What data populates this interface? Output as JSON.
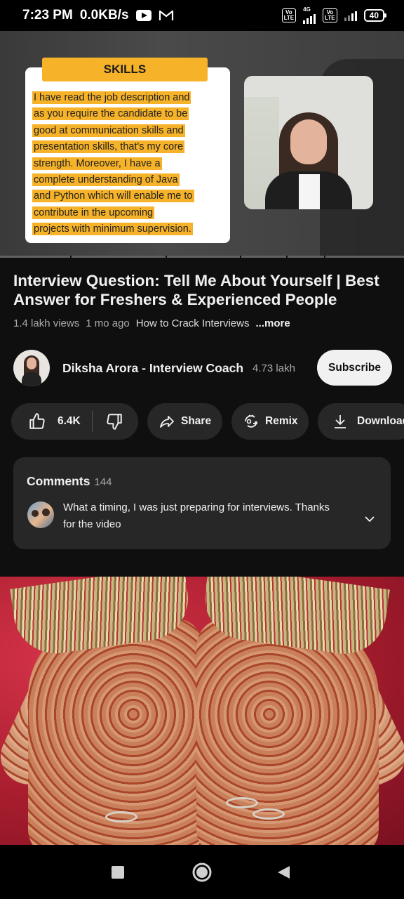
{
  "status_bar": {
    "time": "7:23 PM",
    "speed": "0.0KB/s",
    "network_label": "4G",
    "volte": "Vo LTE",
    "battery": "40"
  },
  "player": {
    "skills_tag": "SKILLS",
    "skills_lines": [
      "I have read the job description and",
      "as you require the candidate to be",
      "good at communication skills and",
      "presentation skills, that's my core",
      "strength. Moreover, I have a",
      "complete understanding of Java",
      "and Python which will enable me to",
      "contribute in the upcoming",
      "projects with minimum supervision."
    ]
  },
  "video": {
    "title": "Interview Question: Tell Me About Yourself | Best Answer for Freshers & Experienced People",
    "views": "1.4 lakh views",
    "age": "1 mo ago",
    "playlist": "How to Crack Interviews",
    "more": "...more"
  },
  "channel": {
    "name": "Diksha Arora - Interview Coach",
    "subscribers": "4.73 lakh",
    "subscribe_label": "Subscribe"
  },
  "actions": {
    "like_count": "6.4K",
    "share_label": "Share",
    "remix_label": "Remix",
    "download_label": "Download"
  },
  "comments": {
    "header": "Comments",
    "count": "144",
    "top_comment": "What a timing, I was just preparing for interviews. Thanks for the video"
  },
  "colors": {
    "background": "#0f0f0f",
    "surface": "#272727",
    "highlight": "#f6b228",
    "subscribe_bg": "#f1f1f1"
  }
}
